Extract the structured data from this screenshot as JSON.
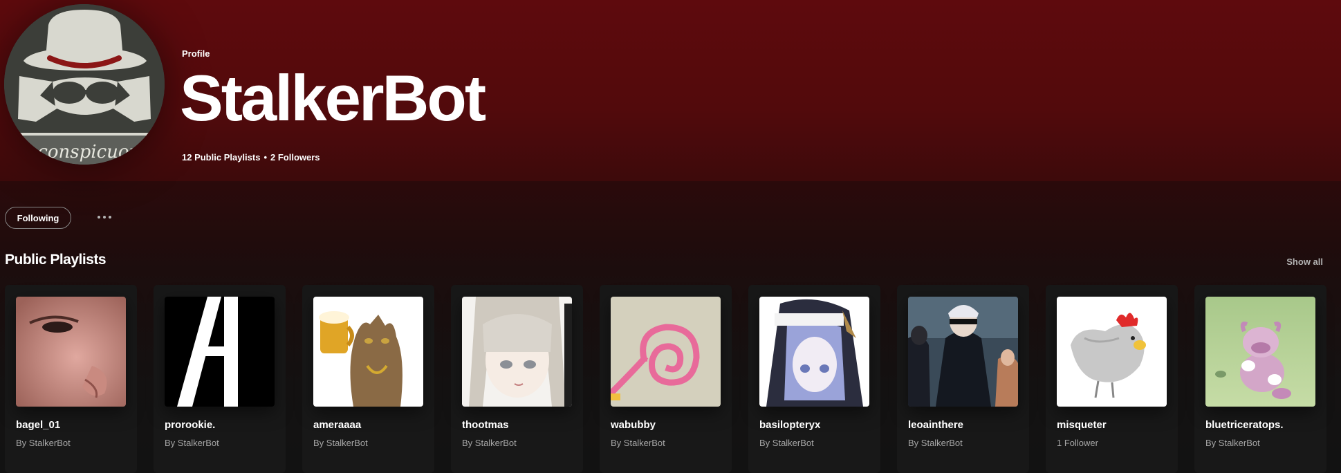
{
  "profile": {
    "eyebrow": "Profile",
    "name": "StalkerBot",
    "playlists_count": "12 Public Playlists",
    "separator": "•",
    "followers_count": "2 Followers",
    "avatar_caption": "Inconspicuous"
  },
  "actions": {
    "following_label": "Following",
    "more_icon": "more-horizontal-icon"
  },
  "section": {
    "title": "Public Playlists",
    "show_all_label": "Show all"
  },
  "playlists": [
    {
      "title": "bagel_01",
      "subtitle": "By StalkerBot"
    },
    {
      "title": "prorookie.",
      "subtitle": "By StalkerBot"
    },
    {
      "title": "ameraaaa",
      "subtitle": "By StalkerBot"
    },
    {
      "title": "thootmas",
      "subtitle": "By StalkerBot"
    },
    {
      "title": "wabubby",
      "subtitle": "By StalkerBot"
    },
    {
      "title": "basilopteryx",
      "subtitle": "By StalkerBot"
    },
    {
      "title": "leoainthere",
      "subtitle": "By StalkerBot"
    },
    {
      "title": "misqueter",
      "subtitle": "1 Follower"
    },
    {
      "title": "bluetriceratops.",
      "subtitle": "By StalkerBot"
    }
  ],
  "colors": {
    "hero_top": "#5e0a0d",
    "card_bg": "#181818",
    "subtext": "#a7a7a7"
  }
}
